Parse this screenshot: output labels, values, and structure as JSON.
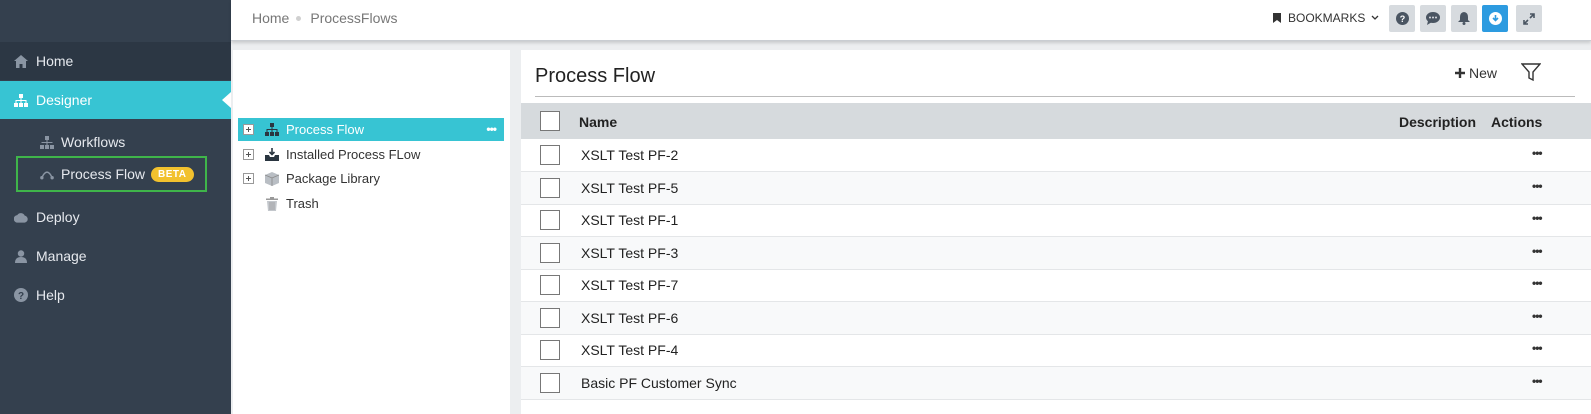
{
  "sidebar": {
    "home": "Home",
    "designer": "Designer",
    "workflows": "Workflows",
    "process_flow": "Process Flow",
    "beta_badge": "BETA",
    "deploy": "Deploy",
    "manage": "Manage",
    "help": "Help"
  },
  "topbar": {
    "breadcrumb": [
      "Home",
      "ProcessFlows"
    ],
    "bookmarks_label": "BOOKMARKS",
    "icons": [
      "help-icon",
      "chat-icon",
      "bell-icon",
      "download-icon",
      "expand-icon"
    ]
  },
  "tree": {
    "items": [
      {
        "label": "Process Flow",
        "icon": "sitemap-icon",
        "expandable": true,
        "selected": true
      },
      {
        "label": "Installed Process FLow",
        "icon": "inbox-download-icon",
        "expandable": true,
        "selected": false
      },
      {
        "label": "Package Library",
        "icon": "package-icon",
        "expandable": true,
        "selected": false
      },
      {
        "label": "Trash",
        "icon": "trash-icon",
        "expandable": false,
        "selected": false
      }
    ],
    "more_label": "•••"
  },
  "content": {
    "title": "Process Flow",
    "new_label": "New",
    "columns": {
      "name": "Name",
      "description": "Description",
      "actions": "Actions"
    },
    "rows": [
      {
        "name": "XSLT Test PF-2",
        "actions": "•••"
      },
      {
        "name": "XSLT Test PF-5",
        "actions": "•••"
      },
      {
        "name": "XSLT Test PF-1",
        "actions": "•••"
      },
      {
        "name": "XSLT Test PF-3",
        "actions": "•••"
      },
      {
        "name": "XSLT Test PF-7",
        "actions": "•••"
      },
      {
        "name": "XSLT Test PF-6",
        "actions": "•••"
      },
      {
        "name": "XSLT Test PF-4",
        "actions": "•••"
      },
      {
        "name": "Basic PF Customer Sync",
        "actions": "•••"
      }
    ]
  },
  "colors": {
    "sidebar": "#34404e",
    "accent": "#37c4d3",
    "highlight_border": "#3fb54a",
    "beta": "#f2c12e",
    "download_button": "#2d9be0"
  }
}
